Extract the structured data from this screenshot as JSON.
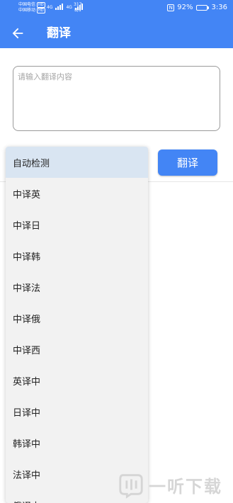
{
  "status_bar": {
    "carrier1": "中国电信",
    "carrier1_badge": "HD",
    "carrier2": "中国移动",
    "carrier2_badge": "HD",
    "net1": "4G",
    "net2": "4G",
    "net_speed_value": "317",
    "net_speed_unit": "B/s",
    "battery_percent_text": "92%",
    "battery_level": 0.92,
    "time": "3:36"
  },
  "app_bar": {
    "title": "翻译",
    "back_icon": "arrow-left-icon"
  },
  "input": {
    "placeholder": "请输入翻译内容",
    "value": ""
  },
  "translate_button": {
    "label": "翻译"
  },
  "dropdown": {
    "selected_index": 0,
    "options": [
      "自动检测",
      "中译英",
      "中译日",
      "中译韩",
      "中译法",
      "中译俄",
      "中译西",
      "英译中",
      "日译中",
      "韩译中",
      "法译中",
      "俄译中"
    ]
  },
  "watermark": {
    "text": "一听下载"
  },
  "colors": {
    "primary": "#4385f5",
    "selected_bg": "#d9e5f2",
    "dropdown_bg": "#f2f2f2"
  }
}
